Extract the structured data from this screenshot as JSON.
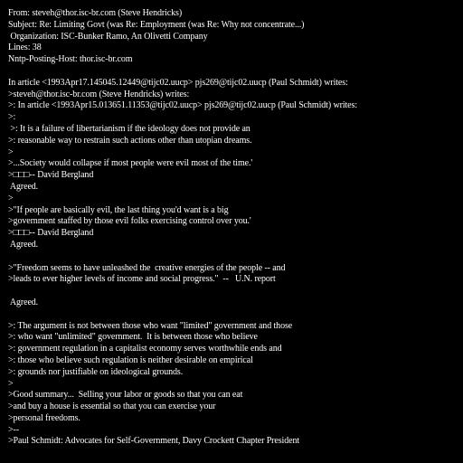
{
  "header": {
    "from": "From: steveh@thor.isc-br.com (Steve Hendricks)",
    "subject": "Subject: Re: Limiting Govt (was Re: Employment (was Re: Why not concentrate...)",
    "organization": " Organization: ISC-Bunker Ramo, An Olivetti Company",
    "lines": "Lines: 38",
    "nntp_host": "Nntp-Posting-Host: thor.isc-br.com"
  },
  "body": {
    "l01": "In article <1993Apr17.145045.12449@tijc02.uucp> pjs269@tijc02.uucp (Paul Schmidt) writes:",
    "l02": ">steveh@thor.isc-br.com (Steve Hendricks) writes:",
    "l03": ">: In article <1993Apr15.013651.11353@tijc02.uucp> pjs269@tijc02.uucp (Paul Schmidt) writes:",
    "l04": ">:",
    "l05": " >: It is a failure of libertarianism if the ideology does not provide an",
    "l06": ">: reasonable way to restrain such actions other than utopian dreams.",
    "l07": ">",
    "l08": ">...Society would collapse if most people were evil most of the time.'",
    "l09": ">□□□-- David Bergland",
    "l10": " Agreed.",
    "l11": ">",
    "l12": ">\"If people are basically evil, the last thing you'd want is a big",
    "l13": ">government staffed by those evil folks exercising control over you.'",
    "l14": ">□□□-- David Bergland",
    "l15": " Agreed.",
    "l16": ">\"Freedom seems to have unleashed the  creative energies of the people -- and",
    "l17": ">leads to ever higher levels of income and social progress.\"  --   U.N. report",
    "l18": " Agreed.",
    "l19": ">: The argument is not between those who want \"limited\" government and those",
    "l20": ">: who want \"unlimited\" government.  It is between those who believe",
    "l21": ">: government regulation in a capitalist economy serves worthwhile ends and",
    "l22": ">: those who believe such regulation is neither desirable on empirical",
    "l23": ">: grounds nor justifiable on ideological grounds.",
    "l24": ">",
    "l25": ">Good summary...  Selling your labor or goods so that you can eat",
    "l26": ">and buy a house is essential so that you can exercise your",
    "l27": ">personal freedoms.",
    "l28": ">--",
    "l29": ">Paul Schmidt: Advocates for Self-Government, Davy Crockett Chapter President"
  },
  "colors": {
    "background": "#000000",
    "text": "#ffffff"
  }
}
